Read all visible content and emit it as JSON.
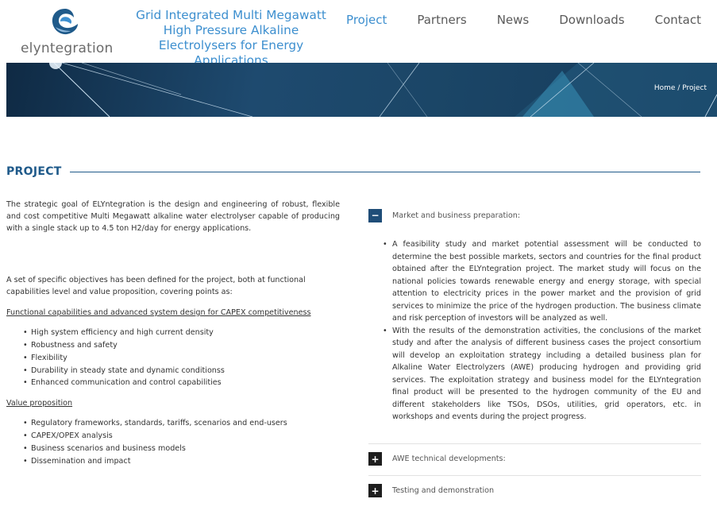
{
  "header": {
    "logo_text": "elyntegration",
    "tagline": "Grid Integrated Multi Megawatt High Pressure Alkaline Electrolysers for Energy Applications",
    "nav": [
      {
        "label": "Project",
        "active": true
      },
      {
        "label": "Partners",
        "active": false
      },
      {
        "label": "News",
        "active": false
      },
      {
        "label": "Downloads",
        "active": false
      },
      {
        "label": "Contact",
        "active": false
      }
    ]
  },
  "banner": {
    "breadcrumb": "Home / Project"
  },
  "section": {
    "title": "PROJECT"
  },
  "left": {
    "intro": "The strategic goal of ELYntegration is the design and engineering of robust, flexible and cost competitive Multi Megawatt alkaline water electrolyser capable of producing with a single stack up to 4.5 ton H2/day for energy applications.",
    "objectives": "A set of specific objectives has been defined for the project, both at functional capabilities level and value proposition, covering points as:",
    "functional_heading": "Functional capabilities and advanced system design for CAPEX competitiveness",
    "functional_items": [
      "High system efficiency and high current density",
      "Robustness and safety",
      "Flexibility",
      "Durability in steady state and dynamic conditionss",
      "Enhanced communication and control capabilities"
    ],
    "value_heading": "Value proposition",
    "value_items": [
      "Regulatory frameworks, standards, tariffs, scenarios and end-users",
      "CAPEX/OPEX analysis",
      "Business scenarios and business models",
      "Dissemination and impact"
    ]
  },
  "accordion": {
    "items": [
      {
        "icon": "−",
        "title": "Market and business preparation:",
        "bullets": [
          "A feasibility study and market potential assessment will be conducted to determine the best possible markets, sectors and countries for the final product obtained after the ELYntegration project. The market study will focus on the national policies towards renewable energy and energy storage, with special attention to electricity prices in the power market and the provision of grid services to minimize the price of the hydrogen production. The business climate and risk perception of investors will be analyzed as well.",
          "With the results of the demonstration activities, the conclusions of the market study and after the analysis of different business cases the project consortium will develop an exploitation strategy including a detailed business plan for Alkaline Water Electrolyzers (AWE) producing hydrogen and providing grid services. The exploitation strategy and business model for the ELYntegration final product will be presented to the hydrogen community of the EU and different stakeholders like TSOs, DSOs, utilities, grid operators, etc. in workshops and events during the project progress."
        ]
      },
      {
        "icon": "+",
        "title": "AWE technical developments:"
      },
      {
        "icon": "+",
        "title": "Testing and demonstration"
      }
    ]
  }
}
